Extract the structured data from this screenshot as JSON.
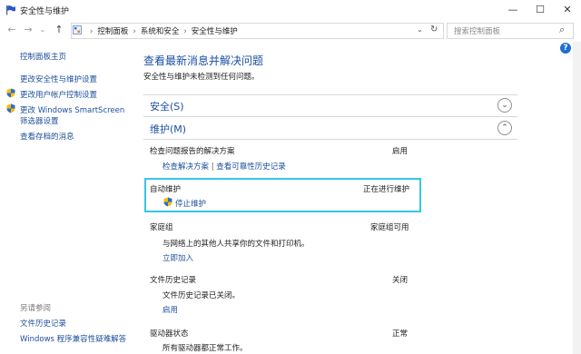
{
  "window": {
    "title": "安全性与维护",
    "minimize": "—",
    "maximize": "☐",
    "close": "✕"
  },
  "nav": {
    "back": "←",
    "forward": "→",
    "dropdown": "⌄",
    "up": "↑",
    "breadcrumbs": [
      "控制面板",
      "系统和安全",
      "安全性与维护"
    ],
    "breadcrumb_sep": "›",
    "address_dropdown": "⌄",
    "refresh": "↻",
    "search_placeholder": "搜索控制面板",
    "search_icon": "⌕"
  },
  "sidebar": {
    "items": [
      {
        "label": "控制面板主页"
      },
      {
        "label": "更改安全性与维护设置"
      },
      {
        "label": "更改用户帐户控制设置"
      },
      {
        "label": "更改 Windows SmartScreen"
      },
      {
        "label": "筛选器设置"
      },
      {
        "label": "查看存档的消息"
      }
    ],
    "see_also_title": "另请参阅",
    "see_also": [
      {
        "label": "文件历史记录"
      },
      {
        "label": "Windows 程序兼容性疑难解答"
      }
    ]
  },
  "main": {
    "title": "查看最新消息并解决问题",
    "subtitle": "安全性与维护未检测到任何问题。",
    "security_header": "安全(S)",
    "maintenance_header": "维护(M)",
    "problem_reports": {
      "label": "检查问题报告的解决方案",
      "status": "启用",
      "link1": "检查解决方案",
      "sep": "|",
      "link2": "查看可靠性历史记录"
    },
    "auto_maintenance": {
      "label": "自动维护",
      "status": "正在进行维护",
      "link": "停止维护"
    },
    "homegroup": {
      "label": "家庭组",
      "status": "家庭组可用",
      "desc": "与网络上的其他人共享你的文件和打印机。",
      "link": "立即加入"
    },
    "file_history": {
      "label": "文件历史记录",
      "status": "关闭",
      "desc": "文件历史记录已关闭。",
      "link": "启用"
    },
    "drive_status": {
      "label": "驱动器状态",
      "status": "正常",
      "desc": "所有驱动器都正常工作。"
    }
  },
  "help": "?"
}
